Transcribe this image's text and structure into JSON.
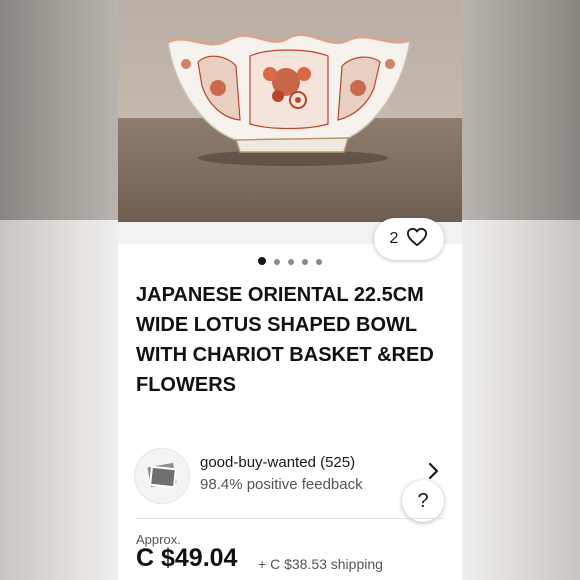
{
  "listing": {
    "image_count_dots": 5,
    "active_image_index": 0,
    "likes": "2",
    "title": "JAPANESE ORIENTAL 22.5CM WIDE LOTUS SHAPED BOWL WITH CHARIOT BASKET &RED FLOWERS"
  },
  "seller": {
    "name": "good-buy-wanted (525)",
    "feedback": "98.4% positive feedback"
  },
  "price": {
    "approx_label": "Approx.",
    "amount": "C $49.04",
    "shipping": "+ C $38.53 shipping"
  },
  "icons": {
    "like": "heart-icon",
    "seller_chevron": "chevron-right-icon",
    "help": "question-icon"
  },
  "colors": {
    "text_primary": "#191919",
    "text_secondary": "#555555",
    "bowl_pattern": "#c0502e"
  },
  "help": {
    "label": "?"
  }
}
